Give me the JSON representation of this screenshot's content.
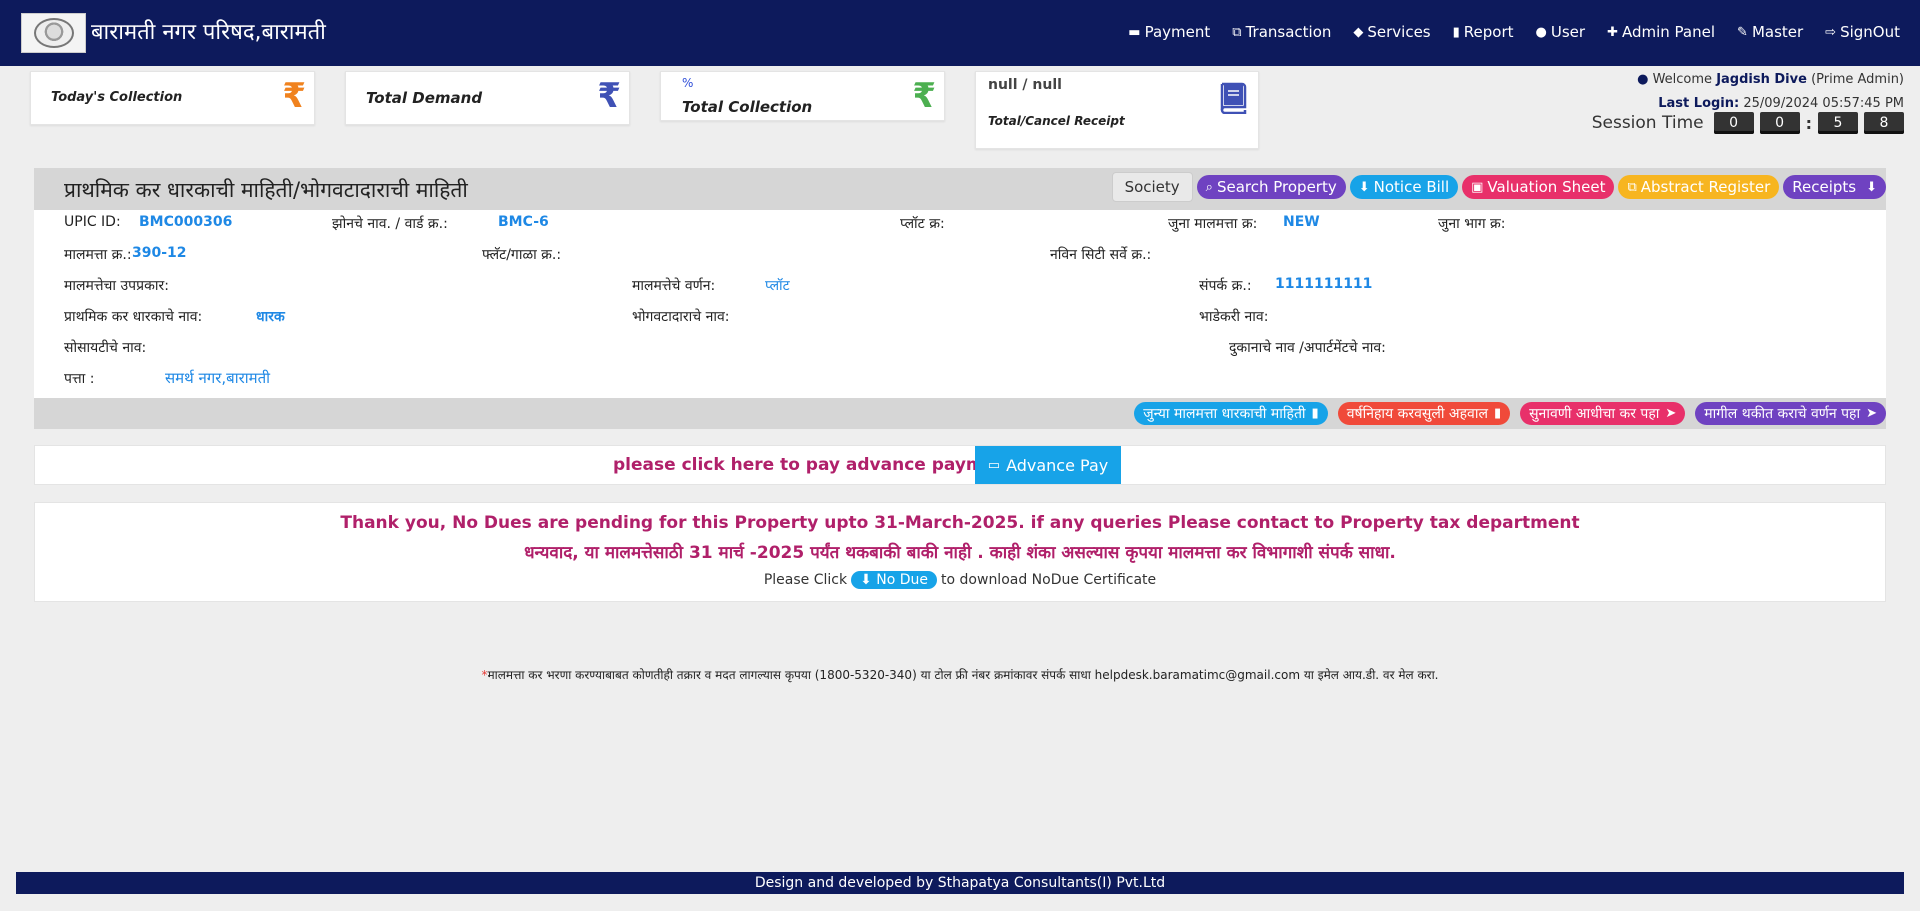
{
  "header": {
    "brand": "बारामती नगर परिषद,बारामती",
    "nav": [
      {
        "label": "Payment",
        "icon": "credit-card-icon"
      },
      {
        "label": "Transaction",
        "icon": "transaction-icon"
      },
      {
        "label": "Services",
        "icon": "tag-icon"
      },
      {
        "label": "Report",
        "icon": "file-icon"
      },
      {
        "label": "User",
        "icon": "user-icon"
      },
      {
        "label": "Admin Panel",
        "icon": "user-plus-icon"
      },
      {
        "label": "Master",
        "icon": "edit-icon"
      },
      {
        "label": "SignOut",
        "icon": "sign-out-icon"
      }
    ]
  },
  "stats": {
    "today": {
      "label": "Today's Collection",
      "icon": "₹",
      "color": "#f0821e"
    },
    "demand": {
      "label": "Total Demand",
      "icon": "₹",
      "color": "#3f51b5"
    },
    "collection": {
      "label": "Total Collection",
      "value": "%",
      "icon": "₹",
      "color": "#4caf50"
    },
    "receipt": {
      "value": "null / null",
      "label": "Total/Cancel Receipt",
      "icon": "book-icon",
      "color": "#3f51b5"
    }
  },
  "user": {
    "welcome_prefix": "Welcome",
    "name": "Jagdish Dive",
    "role": "(Prime Admin)",
    "last_login_label": "Last Login:",
    "last_login_value": "25/09/2024 05:57:45 PM",
    "session_label": "Session Time",
    "session_digits": [
      "0",
      "0",
      "5",
      "8"
    ]
  },
  "panel": {
    "title": "प्राथमिक कर धारकाची माहिती/भोगवटादाराची माहिती",
    "buttons": {
      "society": "Society",
      "search": "Search Property",
      "notice": "Notice Bill",
      "valuation": "Valuation Sheet",
      "abstract": "Abstract Register",
      "receipts": "Receipts"
    },
    "fields": {
      "upic_label": "UPIC ID:",
      "upic_value": "BMC000306",
      "zone_label": "झोनचे नाव. / वार्ड क्र.:",
      "zone_value": "BMC-6",
      "plot_label": "प्लॉट क्र:",
      "old_prop_label": "जुना मालमत्ता क्र:",
      "old_prop_value": "NEW",
      "old_part_label": "जुना भाग क्र:",
      "prop_no_label": "मालमत्ता क्र.:",
      "prop_no_value": "390-12",
      "flat_label": "फ्लॅट/गाळा क्र.:",
      "city_survey_label": "नविन सिटी सर्वे क्र.:",
      "subtype_label": "मालमत्तेचा उपप्रकार:",
      "desc_label": "मालमत्तेचे वर्णन:",
      "desc_value": "प्लॉट",
      "contact_label": "संपर्क क्र.:",
      "contact_value": "1111111111",
      "holder_label": "प्राथमिक कर धारकाचे नाव:",
      "holder_value": "धारक",
      "occupant_label": "भोगवटादाराचे नाव:",
      "tenant_label": "भाडेकरी नाव:",
      "society_label": "सोसायटीचे नाव:",
      "shop_label": "दुकानाचे नाव /अपार्टमेंटचे नाव:",
      "address_label": "पत्ता :",
      "address_value": "समर्थ नगर,बारामती"
    },
    "footer_buttons": {
      "old_owner": "जुन्या मालमत्ता धारकाची माहिती",
      "yearly": "वर्षनिहाय करवसुली अहवाल",
      "hearing": "सुनावणी आधीचा कर पहा",
      "arrears": "मागील थकीत कराचे वर्णन पहा"
    }
  },
  "advance": {
    "text": "please click here to pay advance payment",
    "button": "Advance Pay"
  },
  "nodue": {
    "line1": "Thank you, No Dues are pending for this Property upto 31-March-2025. if any queries Please contact to Property tax department",
    "line2": "धन्यवाद, या मालमत्तेसाठी 31 मार्च -2025 पर्यंत थकबाकी बाकी नाही . काही शंका असल्यास कृपया मालमत्ता कर विभागाशी संपर्क साधा.",
    "prefix": "Please Click",
    "button": "No Due",
    "suffix": "to download NoDue Certificate"
  },
  "helpline": {
    "star": "*",
    "text": "मालमत्ता कर भरणा करण्याबाबत कोणतीही तक्रार व मदत लागल्यास कृपया (1800-5320-340) या टोल फ्री नंबर क्रमांकावर संपर्क साधा helpdesk.baramatimc@gmail.com या इमेल आय.डी. वर मेल करा."
  },
  "footer": {
    "text": "Design and developed by Sthapatya Consultants(I) Pvt.Ltd"
  },
  "colors": {
    "navy": "#0d1a5c",
    "purple": "#6f42c1",
    "blue": "#17a3e8",
    "pink": "#e8306a",
    "yellow": "#f7b520",
    "magenta": "#b0206a"
  }
}
